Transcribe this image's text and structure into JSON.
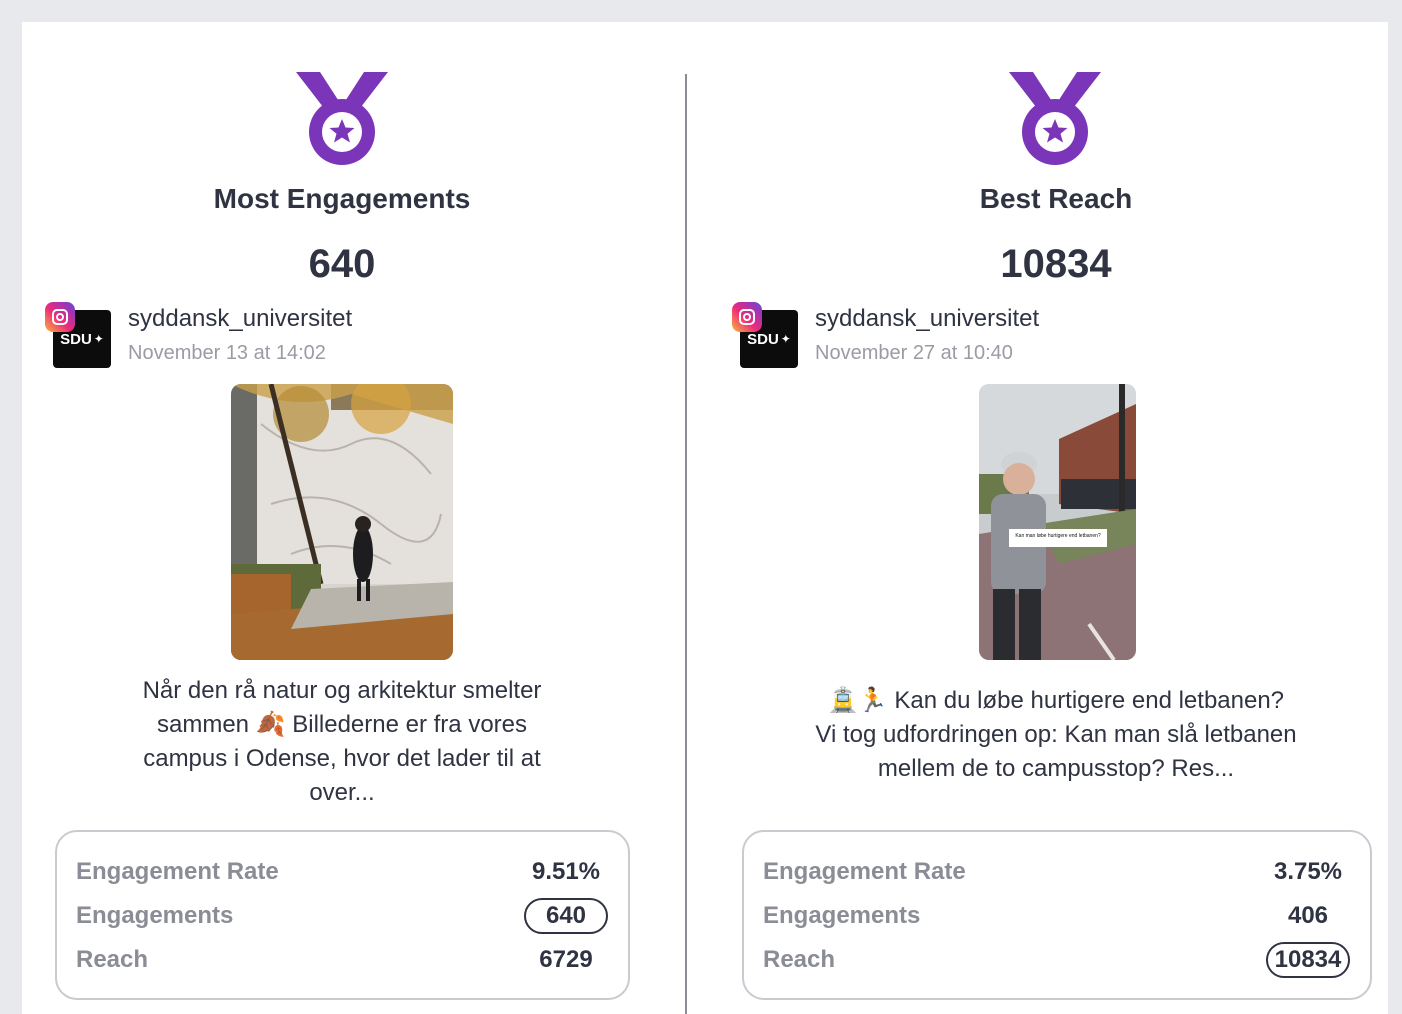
{
  "cards": [
    {
      "title": "Most Engagements",
      "value": "640",
      "account": "syddansk_universitet",
      "date": "November 13 at 14:02",
      "avatar_text": "SDU",
      "caption": "Når den rå natur og arkitektur smelter sammen 🍂 Billederne er fra vores campus i Odense, hvor det lader til at over...",
      "stats": [
        {
          "label": "Engagement Rate",
          "value": "9.51%"
        },
        {
          "label": "Engagements",
          "value": "640"
        },
        {
          "label": "Reach",
          "value": "6729"
        }
      ]
    },
    {
      "title": "Best Reach",
      "value": "10834",
      "account": "syddansk_universitet",
      "date": "November 27 at 10:40",
      "avatar_text": "SDU",
      "caption": "🚊🏃 Kan du løbe hurtigere end letbanen? Vi tog udfordringen op: Kan man slå letbanen mellem de to campusstop? Res...",
      "thumb_overlay": "Kan man løbe hurtigere end letbanen?",
      "stats": [
        {
          "label": "Engagement Rate",
          "value": "3.75%"
        },
        {
          "label": "Engagements",
          "value": "406"
        },
        {
          "label": "Reach",
          "value": "10834"
        }
      ]
    }
  ],
  "icons": {
    "medal": "medal-icon",
    "platform": "instagram-icon"
  },
  "colors": {
    "medal": "#7b35b8",
    "text": "#2f3342",
    "muted": "#8a8d96"
  }
}
